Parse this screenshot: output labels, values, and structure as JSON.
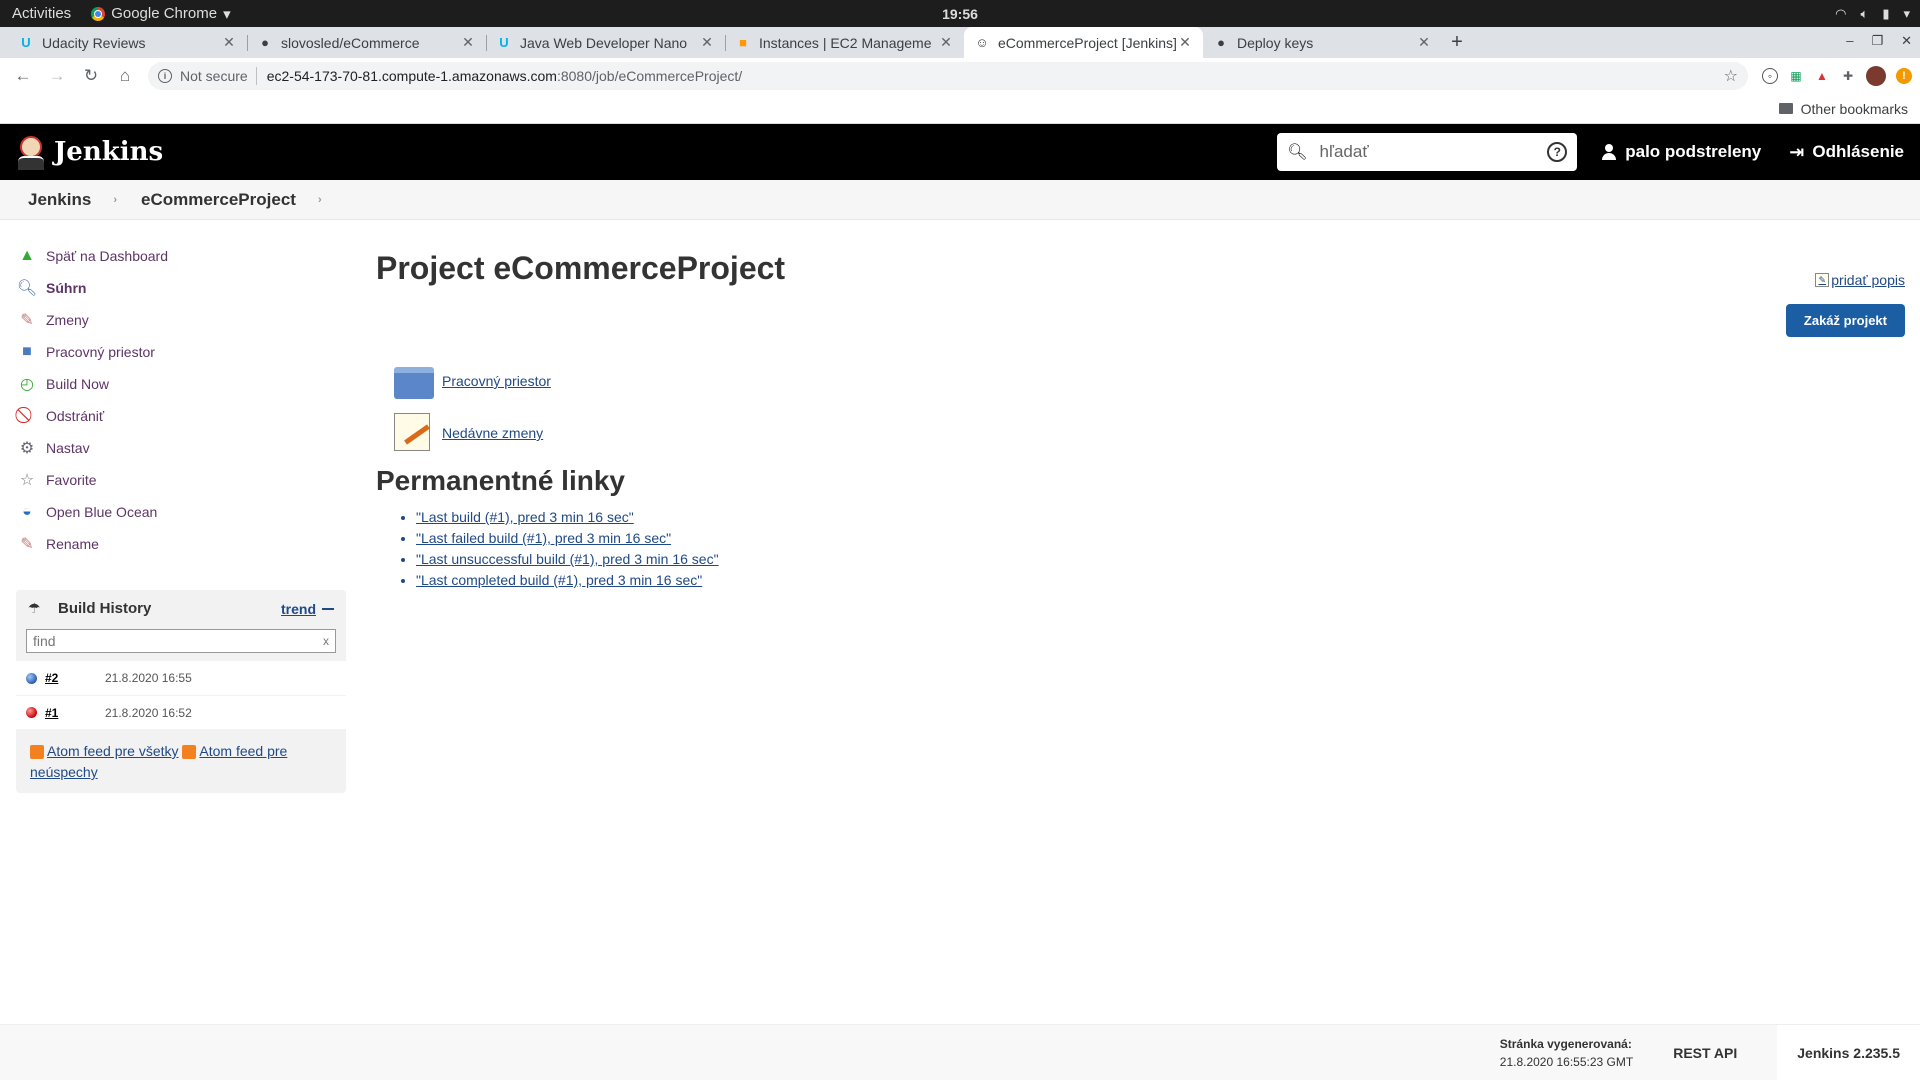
{
  "system": {
    "activities": "Activities",
    "app_name": "Google Chrome",
    "clock": "19:56"
  },
  "tabs": [
    {
      "title": "Udacity Reviews",
      "icon": "udacity-icon"
    },
    {
      "title": "slovosled/eCommerce",
      "icon": "github-icon"
    },
    {
      "title": "Java Web Developer Nano",
      "icon": "udacity-icon"
    },
    {
      "title": "Instances | EC2 Manageme",
      "icon": "aws-icon"
    },
    {
      "title": "eCommerceProject [Jenkins]",
      "icon": "jenkins-icon",
      "active": true
    },
    {
      "title": "Deploy keys",
      "icon": "github-icon"
    }
  ],
  "address": {
    "not_secure": "Not secure",
    "host": "ec2-54-173-70-81.compute-1.amazonaws.com",
    "path": ":8080/job/eCommerceProject/"
  },
  "bookmarks": {
    "other": "Other bookmarks"
  },
  "jenkins": {
    "brand": "Jenkins",
    "search_placeholder": "hľadať",
    "user": "palo podstreleny",
    "logout": "Odhlásenie",
    "breadcrumb": [
      "Jenkins",
      "eCommerceProject"
    ]
  },
  "sidebar": {
    "items": [
      {
        "label": "Späť na Dashboard",
        "icon": "up-arrow-icon"
      },
      {
        "label": "Súhrn",
        "icon": "magnifier-icon"
      },
      {
        "label": "Zmeny",
        "icon": "notepad-icon"
      },
      {
        "label": "Pracovný priestor",
        "icon": "folder-icon"
      },
      {
        "label": "Build Now",
        "icon": "clock-icon"
      },
      {
        "label": "Odstrániť",
        "icon": "no-entry-icon"
      },
      {
        "label": "Nastav",
        "icon": "gear-icon"
      },
      {
        "label": "Favorite",
        "icon": "star-icon"
      },
      {
        "label": "Open Blue Ocean",
        "icon": "blue-ocean-icon"
      },
      {
        "label": "Rename",
        "icon": "notepad-icon"
      }
    ]
  },
  "build_history": {
    "title": "Build History",
    "trend": "trend",
    "find_placeholder": "find",
    "clear": "x",
    "builds": [
      {
        "number": "#2",
        "date": "21.8.2020 16:55",
        "status": "blue"
      },
      {
        "number": "#1",
        "date": "21.8.2020 16:52",
        "status": "red"
      }
    ],
    "feed_all": "Atom feed pre všetky",
    "feed_failures": "Atom feed pre neúspechy"
  },
  "main": {
    "title": "Project eCommerceProject",
    "add_description": "pridať popis",
    "disable_button": "Zakáž projekt",
    "workspace_link": "Pracovný priestor",
    "recent_changes_link": "Nedávne zmeny",
    "permalinks_heading": "Permanentné linky",
    "permalinks": [
      "\"Last build (#1), pred 3 min 16 sec\"",
      "\"Last failed build (#1), pred 3 min 16 sec\"",
      "\"Last unsuccessful build (#1), pred 3 min 16 sec\"",
      "\"Last completed build (#1), pred 3 min 16 sec\""
    ]
  },
  "footer": {
    "generated_label": "Stránka vygenerovaná:",
    "generated_at": "21.8.2020 16:55:23 GMT",
    "rest_api": "REST API",
    "version": "Jenkins 2.235.5"
  }
}
